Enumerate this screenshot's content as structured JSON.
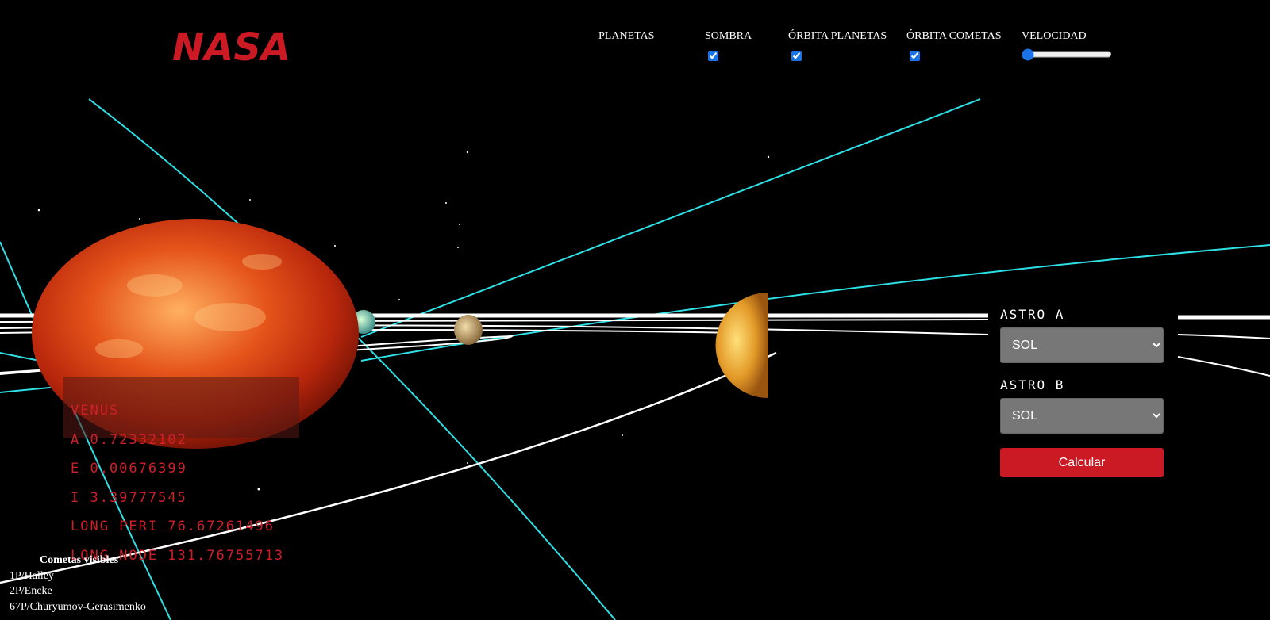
{
  "header": {
    "logo_text": "NASA",
    "toggles": [
      {
        "label": "PLANETAS",
        "has_checkbox": false
      },
      {
        "label": "SOMBRA",
        "checked": true
      },
      {
        "label": "ÓRBITA PLANETAS",
        "checked": true
      },
      {
        "label": "ÓRBITA COMETAS",
        "checked": true
      }
    ],
    "velocidad": {
      "label": "VELOCIDAD",
      "value": 0
    }
  },
  "info_panel": {
    "name": "VENUS",
    "lines": [
      "A  0.72332102",
      "E  0.00676399",
      "I  3.39777545",
      "LONG PERI  76.67261496",
      "LONG NODE  131.76755713"
    ]
  },
  "comets": {
    "title": "Cometas visibles",
    "items": [
      "1P/Halley",
      "2P/Encke",
      "67P/Churyumov-Gerasimenko"
    ]
  },
  "calculator": {
    "astro_a_label": "ASTRO A",
    "astro_a_value": "SOL",
    "astro_b_label": "ASTRO B",
    "astro_b_value": "SOL",
    "button_label": "Calcular"
  },
  "colors": {
    "accent": "#cc1a25",
    "comet_orbit": "#2de0e6",
    "planet_orbit": "#ffffff",
    "background": "#000000"
  }
}
